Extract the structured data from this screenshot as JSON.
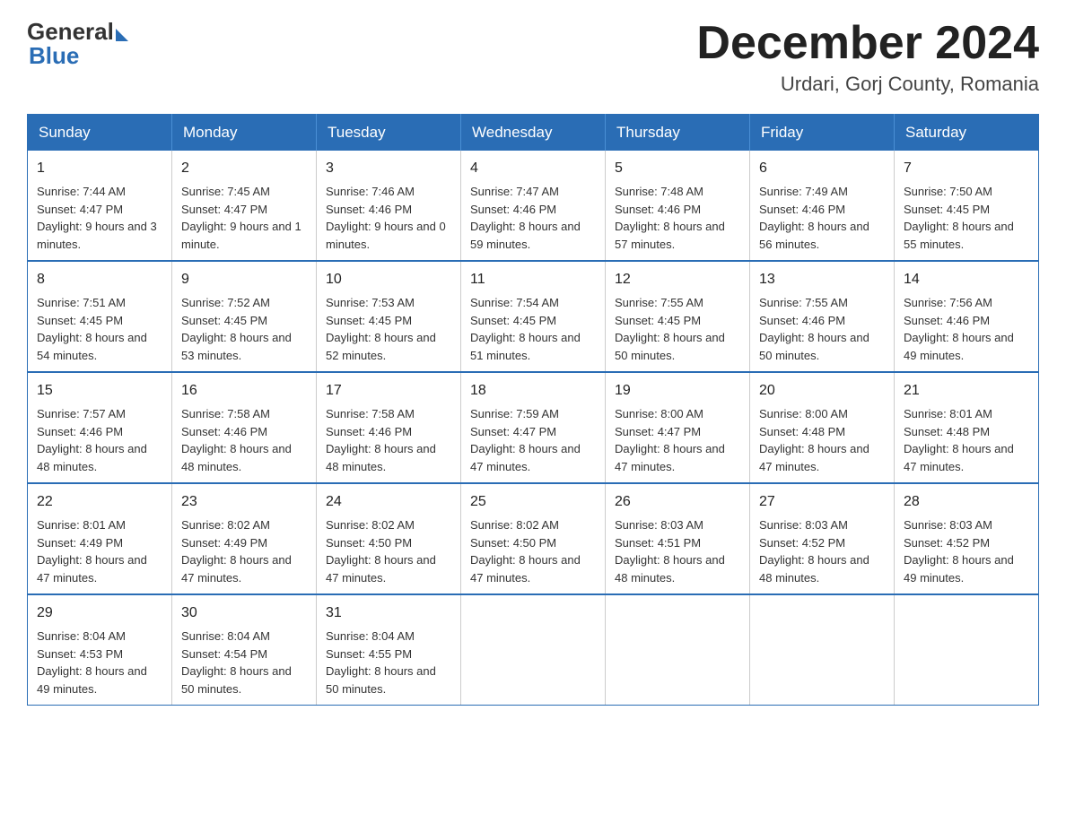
{
  "logo": {
    "general": "General",
    "blue": "Blue"
  },
  "title": {
    "month": "December 2024",
    "location": "Urdari, Gorj County, Romania"
  },
  "headers": [
    "Sunday",
    "Monday",
    "Tuesday",
    "Wednesday",
    "Thursday",
    "Friday",
    "Saturday"
  ],
  "weeks": [
    [
      {
        "day": "1",
        "sunrise": "7:44 AM",
        "sunset": "4:47 PM",
        "daylight": "9 hours and 3 minutes."
      },
      {
        "day": "2",
        "sunrise": "7:45 AM",
        "sunset": "4:47 PM",
        "daylight": "9 hours and 1 minute."
      },
      {
        "day": "3",
        "sunrise": "7:46 AM",
        "sunset": "4:46 PM",
        "daylight": "9 hours and 0 minutes."
      },
      {
        "day": "4",
        "sunrise": "7:47 AM",
        "sunset": "4:46 PM",
        "daylight": "8 hours and 59 minutes."
      },
      {
        "day": "5",
        "sunrise": "7:48 AM",
        "sunset": "4:46 PM",
        "daylight": "8 hours and 57 minutes."
      },
      {
        "day": "6",
        "sunrise": "7:49 AM",
        "sunset": "4:46 PM",
        "daylight": "8 hours and 56 minutes."
      },
      {
        "day": "7",
        "sunrise": "7:50 AM",
        "sunset": "4:45 PM",
        "daylight": "8 hours and 55 minutes."
      }
    ],
    [
      {
        "day": "8",
        "sunrise": "7:51 AM",
        "sunset": "4:45 PM",
        "daylight": "8 hours and 54 minutes."
      },
      {
        "day": "9",
        "sunrise": "7:52 AM",
        "sunset": "4:45 PM",
        "daylight": "8 hours and 53 minutes."
      },
      {
        "day": "10",
        "sunrise": "7:53 AM",
        "sunset": "4:45 PM",
        "daylight": "8 hours and 52 minutes."
      },
      {
        "day": "11",
        "sunrise": "7:54 AM",
        "sunset": "4:45 PM",
        "daylight": "8 hours and 51 minutes."
      },
      {
        "day": "12",
        "sunrise": "7:55 AM",
        "sunset": "4:45 PM",
        "daylight": "8 hours and 50 minutes."
      },
      {
        "day": "13",
        "sunrise": "7:55 AM",
        "sunset": "4:46 PM",
        "daylight": "8 hours and 50 minutes."
      },
      {
        "day": "14",
        "sunrise": "7:56 AM",
        "sunset": "4:46 PM",
        "daylight": "8 hours and 49 minutes."
      }
    ],
    [
      {
        "day": "15",
        "sunrise": "7:57 AM",
        "sunset": "4:46 PM",
        "daylight": "8 hours and 48 minutes."
      },
      {
        "day": "16",
        "sunrise": "7:58 AM",
        "sunset": "4:46 PM",
        "daylight": "8 hours and 48 minutes."
      },
      {
        "day": "17",
        "sunrise": "7:58 AM",
        "sunset": "4:46 PM",
        "daylight": "8 hours and 48 minutes."
      },
      {
        "day": "18",
        "sunrise": "7:59 AM",
        "sunset": "4:47 PM",
        "daylight": "8 hours and 47 minutes."
      },
      {
        "day": "19",
        "sunrise": "8:00 AM",
        "sunset": "4:47 PM",
        "daylight": "8 hours and 47 minutes."
      },
      {
        "day": "20",
        "sunrise": "8:00 AM",
        "sunset": "4:48 PM",
        "daylight": "8 hours and 47 minutes."
      },
      {
        "day": "21",
        "sunrise": "8:01 AM",
        "sunset": "4:48 PM",
        "daylight": "8 hours and 47 minutes."
      }
    ],
    [
      {
        "day": "22",
        "sunrise": "8:01 AM",
        "sunset": "4:49 PM",
        "daylight": "8 hours and 47 minutes."
      },
      {
        "day": "23",
        "sunrise": "8:02 AM",
        "sunset": "4:49 PM",
        "daylight": "8 hours and 47 minutes."
      },
      {
        "day": "24",
        "sunrise": "8:02 AM",
        "sunset": "4:50 PM",
        "daylight": "8 hours and 47 minutes."
      },
      {
        "day": "25",
        "sunrise": "8:02 AM",
        "sunset": "4:50 PM",
        "daylight": "8 hours and 47 minutes."
      },
      {
        "day": "26",
        "sunrise": "8:03 AM",
        "sunset": "4:51 PM",
        "daylight": "8 hours and 48 minutes."
      },
      {
        "day": "27",
        "sunrise": "8:03 AM",
        "sunset": "4:52 PM",
        "daylight": "8 hours and 48 minutes."
      },
      {
        "day": "28",
        "sunrise": "8:03 AM",
        "sunset": "4:52 PM",
        "daylight": "8 hours and 49 minutes."
      }
    ],
    [
      {
        "day": "29",
        "sunrise": "8:04 AM",
        "sunset": "4:53 PM",
        "daylight": "8 hours and 49 minutes."
      },
      {
        "day": "30",
        "sunrise": "8:04 AM",
        "sunset": "4:54 PM",
        "daylight": "8 hours and 50 minutes."
      },
      {
        "day": "31",
        "sunrise": "8:04 AM",
        "sunset": "4:55 PM",
        "daylight": "8 hours and 50 minutes."
      },
      null,
      null,
      null,
      null
    ]
  ],
  "labels": {
    "sunrise": "Sunrise: ",
    "sunset": "Sunset: ",
    "daylight": "Daylight: "
  }
}
